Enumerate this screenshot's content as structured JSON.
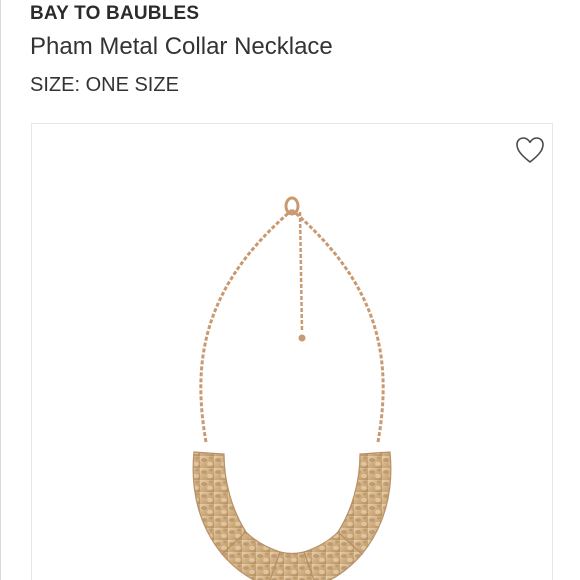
{
  "product": {
    "brand": "BAY TO BAUBLES",
    "title": "Pham Metal Collar Necklace",
    "size_line": "SIZE: ONE SIZE"
  },
  "media": {
    "image_subject": "necklace-product-photo",
    "favorite_icon": "heart-icon"
  },
  "colors": {
    "metal": "#d8b98f",
    "metal_dark": "#9c7a4f",
    "chain": "#c99a72",
    "background": "#ffffff"
  }
}
